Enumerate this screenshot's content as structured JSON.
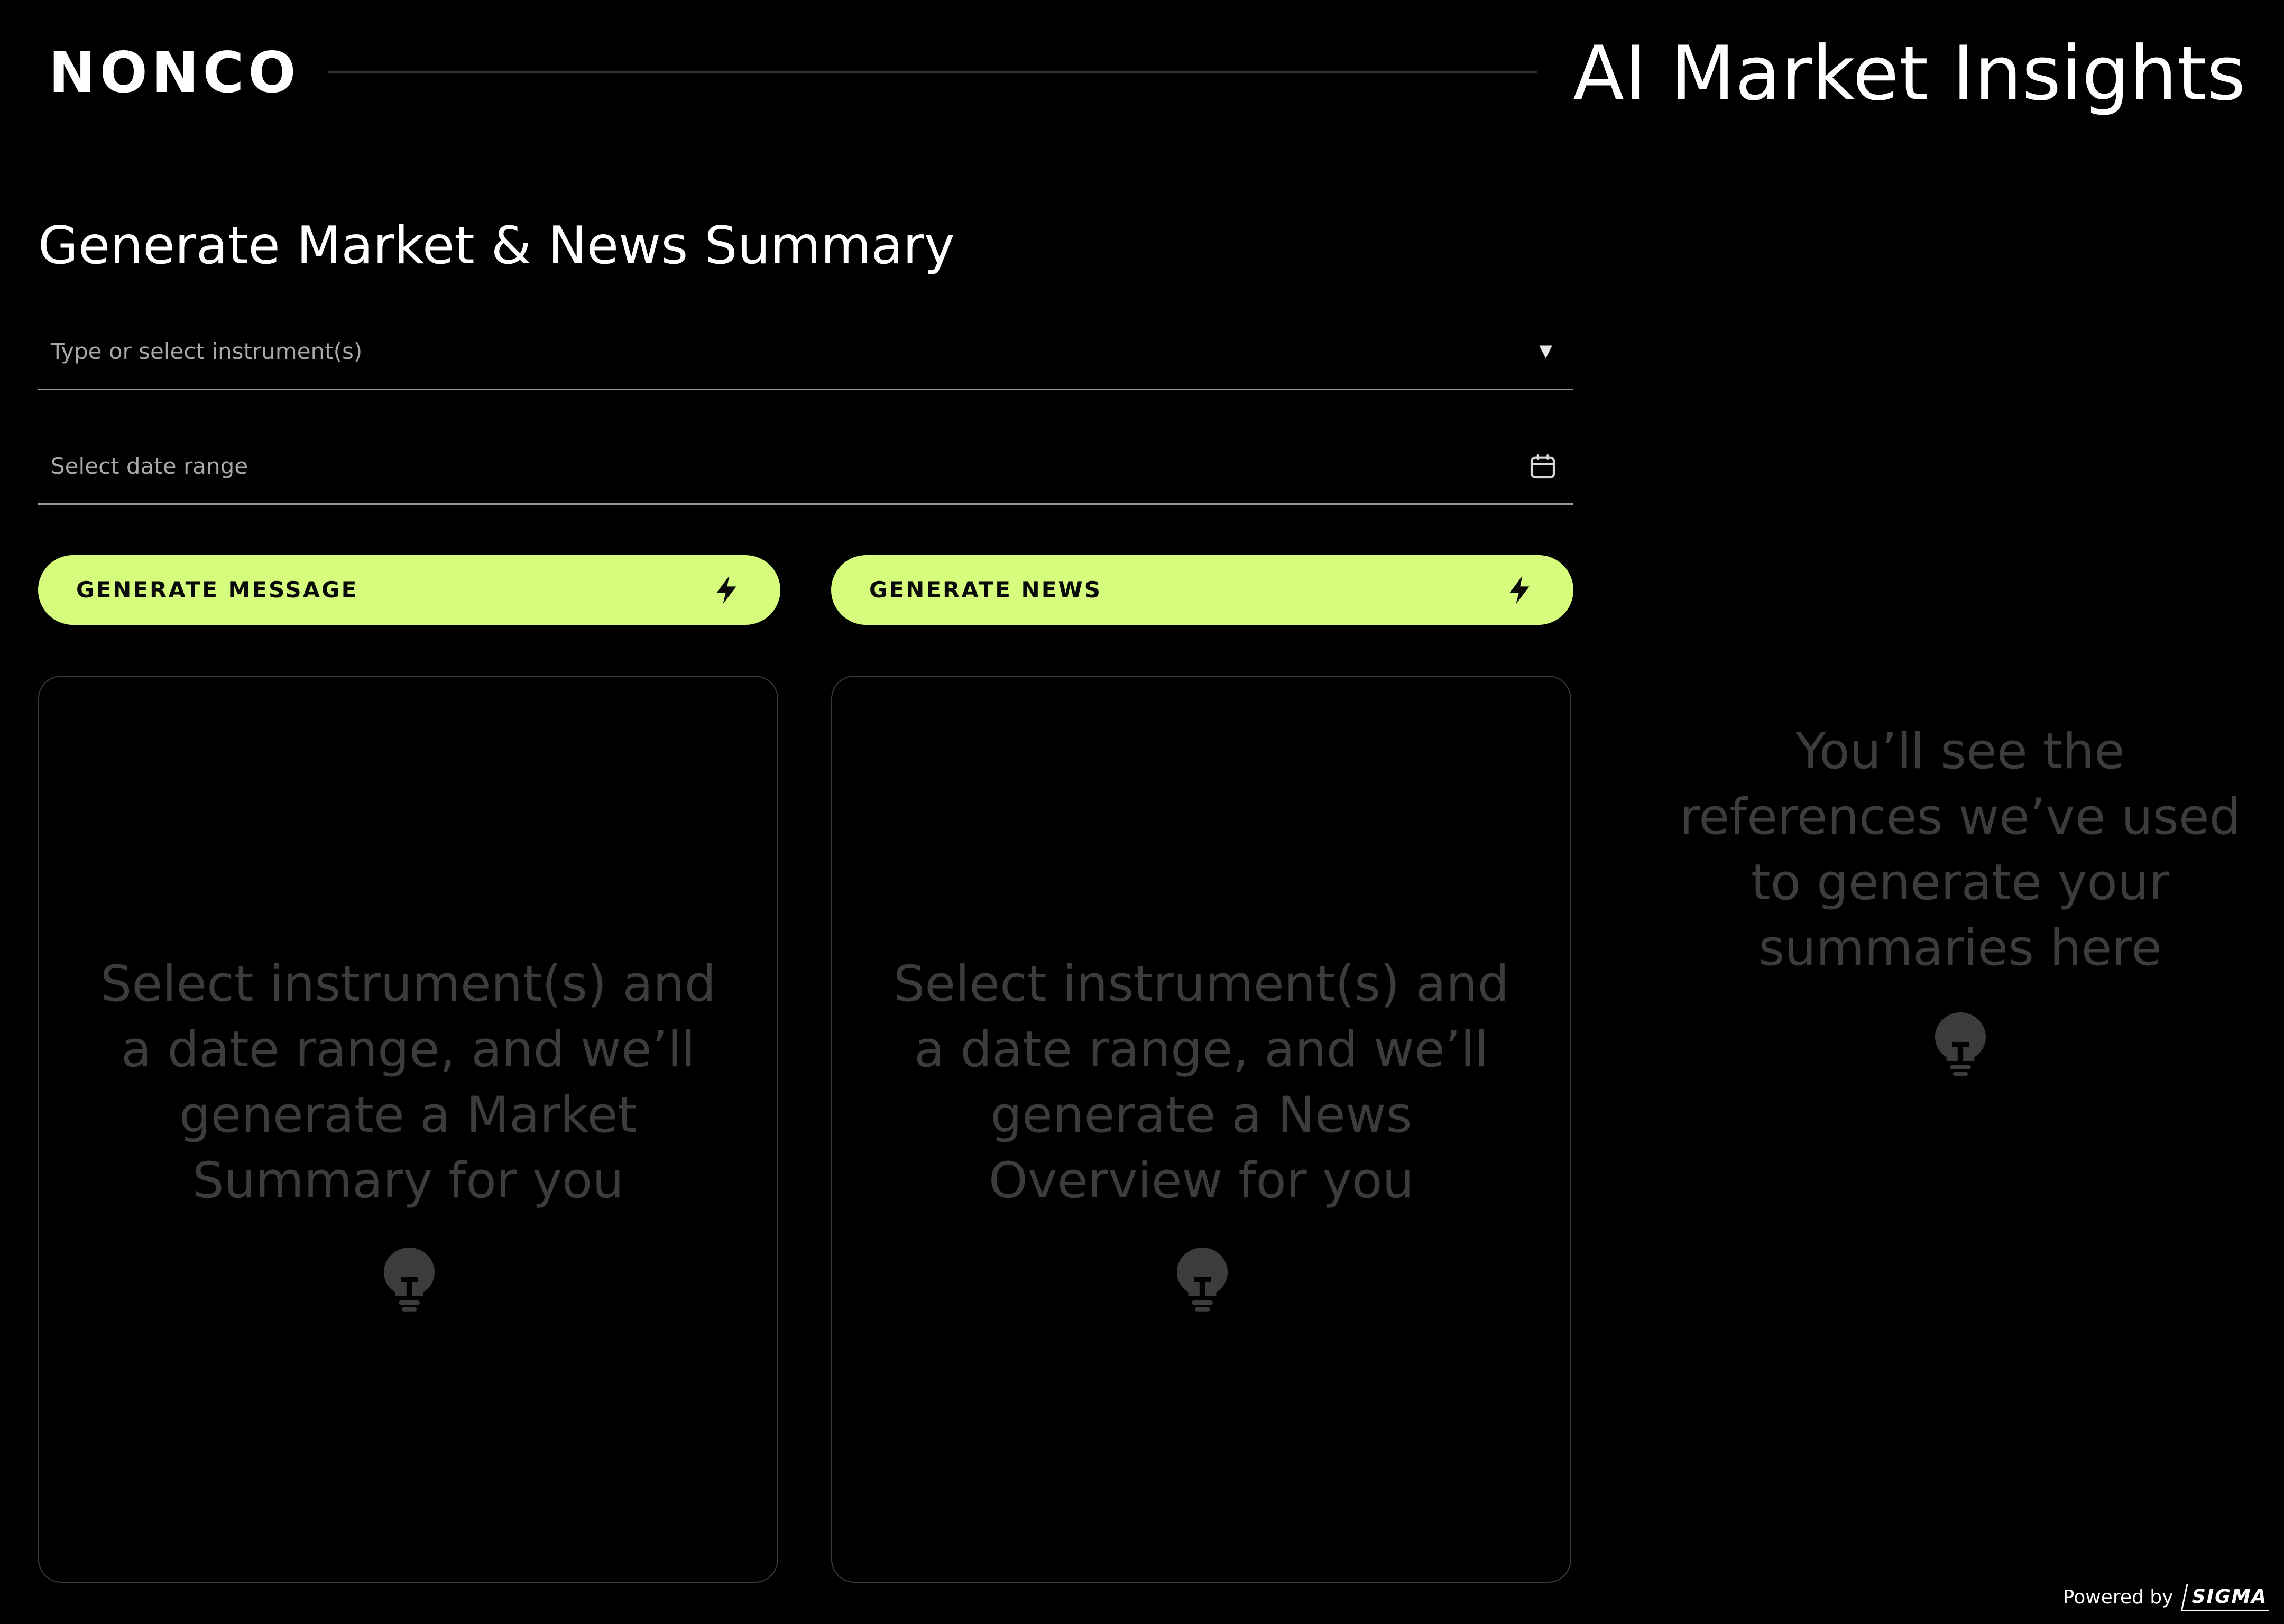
{
  "header": {
    "brand": "NONCO",
    "title": "AI Market Insights"
  },
  "main": {
    "title": "Generate Market & News Summary",
    "instrument_field": {
      "placeholder": "Type or select instrument(s)",
      "icon": "caret-down-icon"
    },
    "date_field": {
      "placeholder": "Select date range",
      "icon": "calendar-icon"
    },
    "buttons": {
      "message": {
        "label": "GENERATE MESSAGE",
        "icon": "lightning-bolt-icon"
      },
      "news": {
        "label": "GENERATE NEWS",
        "icon": "lightning-bolt-icon"
      }
    },
    "panels": {
      "message": {
        "text": "Select instrument(s) and a date range, and we’ll generate a Market Summary for you",
        "icon": "lightbulb-icon"
      },
      "news": {
        "text": "Select instrument(s) and a date range, and we’ll generate a News Overview for you",
        "icon": "lightbulb-icon"
      }
    }
  },
  "references": {
    "text": "You’ll see the references we’ve used to generate your summaries here",
    "icon": "lightbulb-icon"
  },
  "footer": {
    "powered_by": "Powered by",
    "logo": "SIGMA"
  },
  "colors": {
    "background": "#000000",
    "accent": "#d6fc7e",
    "placeholder_text": "#3c3c3c",
    "field_underline": "#9a9a9a"
  }
}
